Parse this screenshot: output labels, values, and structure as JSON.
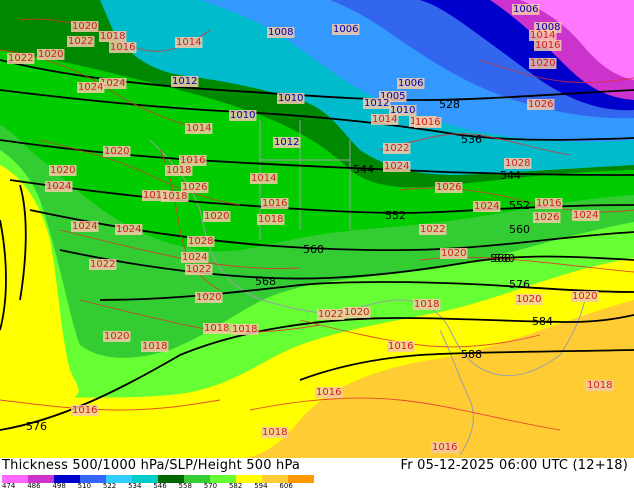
{
  "footer": {
    "title": "Thickness 500/1000 hPa/SLP/Height 500 hPa",
    "valid": "Fr 05-12-2025 06:00 UTC (12+18)"
  },
  "colorscale": {
    "labels": [
      "474",
      "486",
      "498",
      "510",
      "522",
      "534",
      "546",
      "558",
      "570",
      "582",
      "594",
      "606"
    ],
    "colors": [
      "#ff66ff",
      "#cc33cc",
      "#0000cc",
      "#3366ff",
      "#33ccff",
      "#00cccc",
      "#006600",
      "#33cc33",
      "#66ff33",
      "#ffff00",
      "#ffcc33",
      "#ff9900"
    ]
  },
  "height_labels": [
    "528",
    "536",
    "544",
    "544",
    "552",
    "552",
    "560",
    "560",
    "560",
    "568",
    "568",
    "576",
    "576",
    "584",
    "588"
  ],
  "slp_labels": [
    "1020",
    "1018",
    "1022",
    "1020",
    "1016",
    "1014",
    "1008",
    "1006",
    "1006",
    "1008",
    "1014",
    "1016",
    "1022",
    "1024",
    "1024",
    "1012",
    "1010",
    "1006",
    "1005",
    "1012",
    "1010",
    "1010",
    "1012",
    "1014",
    "1012",
    "1020",
    "1016",
    "1026",
    "1028",
    "1020",
    "1016",
    "1014",
    "1020",
    "1018",
    "1024",
    "1014",
    "1022",
    "1024",
    "1026",
    "1016",
    "1018",
    "1026",
    "1024",
    "1022",
    "1016",
    "1016",
    "1024",
    "1026",
    "1024",
    "1020",
    "1018",
    "1028",
    "1020",
    "1022",
    "1024",
    "1024",
    "1020",
    "1022",
    "1022",
    "1020",
    "1018",
    "1020",
    "1020",
    "1018",
    "1018",
    "1016",
    "1020",
    "1018",
    "1016",
    "1018",
    "1016",
    "1016",
    "1018"
  ]
}
